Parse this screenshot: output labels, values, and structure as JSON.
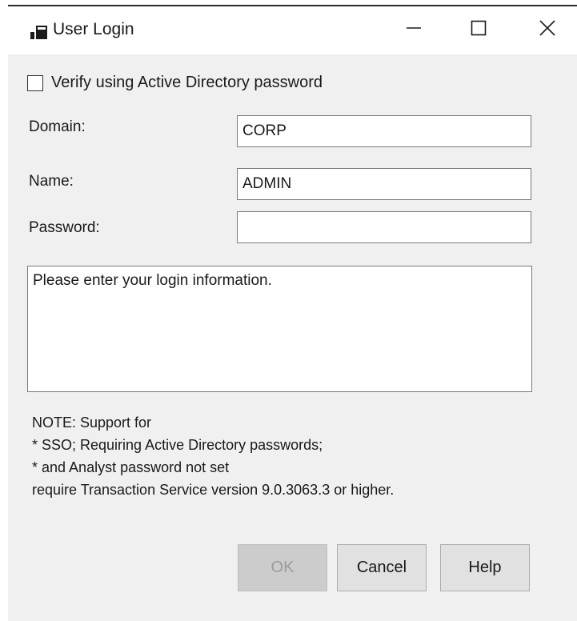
{
  "window": {
    "title": "User Login",
    "icon": "app-window-icon",
    "controls": {
      "minimize": "minimize-icon",
      "maximize": "maximize-icon",
      "close": "close-icon"
    }
  },
  "form": {
    "verify_ad_label": "Verify using Active Directory password",
    "verify_ad_checked": false,
    "domain_label": "Domain:",
    "domain_value": "CORP",
    "name_label": "Name:",
    "name_value": "ADMIN",
    "password_label": "Password:",
    "password_value": ""
  },
  "message": "Please enter your login information.",
  "note": {
    "line1": "NOTE: Support for",
    "line2": "* SSO; Requiring Active Directory passwords;",
    "line3": "* and Analyst password not set",
    "line4": "require Transaction Service version 9.0.3063.3 or higher."
  },
  "buttons": {
    "ok": "OK",
    "ok_enabled": false,
    "cancel": "Cancel",
    "help": "Help"
  },
  "colors": {
    "client_background": "#f0f0f0",
    "button_face": "#e1e1e1",
    "disabled_text": "#9c9c9c"
  }
}
